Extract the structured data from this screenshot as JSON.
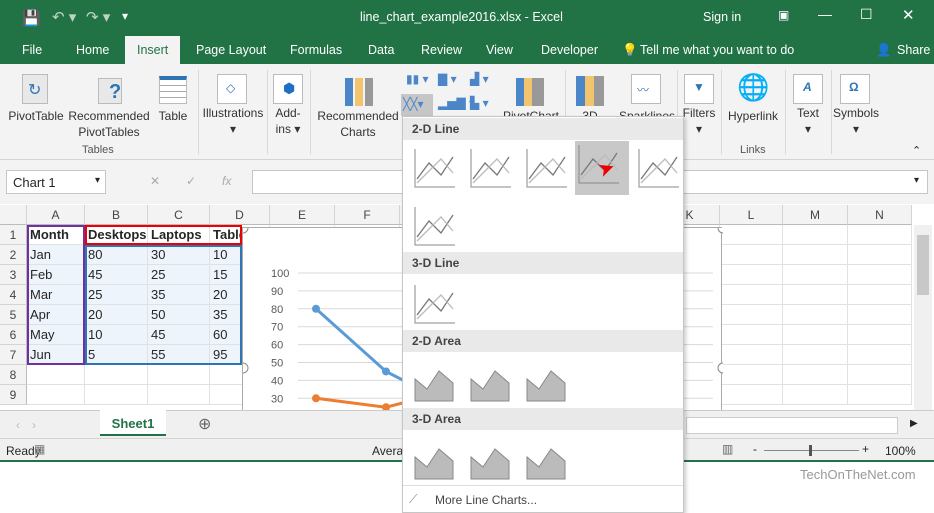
{
  "titlebar": {
    "title": "line_chart_example2016.xlsx - Excel",
    "sign_in": "Sign in"
  },
  "tabs": [
    "File",
    "Home",
    "Insert",
    "Page Layout",
    "Formulas",
    "Data",
    "Review",
    "View",
    "Developer"
  ],
  "tell_me": "Tell me what you want to do",
  "share": "Share",
  "ribbon": {
    "pivottable": "PivotTable",
    "rec_pivot1": "Recommended",
    "rec_pivot2": "PivotTables",
    "table": "Table",
    "tables_group": "Tables",
    "illustrations": "Illustrations",
    "addins1": "Add-",
    "addins2": "ins",
    "rec_charts1": "Recommended",
    "rec_charts2": "Charts",
    "pivotchart": "PivotChart",
    "map3d": "3D",
    "sparklines": "Sparklines",
    "filters": "Filters",
    "hyperlink": "Hyperlink",
    "links_group": "Links",
    "text": "Text",
    "symbols": "Symbols"
  },
  "namebox": "Chart 1",
  "fx": "fx",
  "columns": [
    "A",
    "B",
    "C",
    "D",
    "E",
    "F",
    "G",
    "H",
    "I",
    "J",
    "K",
    "L",
    "M",
    "N"
  ],
  "rows": [
    "1",
    "2",
    "3",
    "4",
    "5",
    "6",
    "7",
    "8",
    "9"
  ],
  "table": {
    "headers": [
      "Month",
      "Desktops",
      "Laptops",
      "Tablets"
    ],
    "data": [
      [
        "Jan",
        "80",
        "30",
        "10"
      ],
      [
        "Feb",
        "45",
        "25",
        "15"
      ],
      [
        "Mar",
        "25",
        "35",
        "20"
      ],
      [
        "Apr",
        "20",
        "50",
        "35"
      ],
      [
        "May",
        "10",
        "45",
        "60"
      ],
      [
        "Jun",
        "5",
        "55",
        "95"
      ]
    ]
  },
  "chart_axis": [
    "100",
    "90",
    "80",
    "70",
    "60",
    "50",
    "40",
    "30"
  ],
  "chart_colors": {
    "desktops": "#5b9bd5",
    "laptops": "#ed7d31"
  },
  "sheet_tab": "Sheet1",
  "status": {
    "ready": "Ready",
    "average": "Avera",
    "zoom": "100%"
  },
  "dropdown": {
    "sec1": "2-D Line",
    "sec2": "3-D Line",
    "sec3": "2-D Area",
    "sec4": "3-D Area",
    "more": "More Line Charts..."
  },
  "watermark": "TechOnTheNet.com"
}
